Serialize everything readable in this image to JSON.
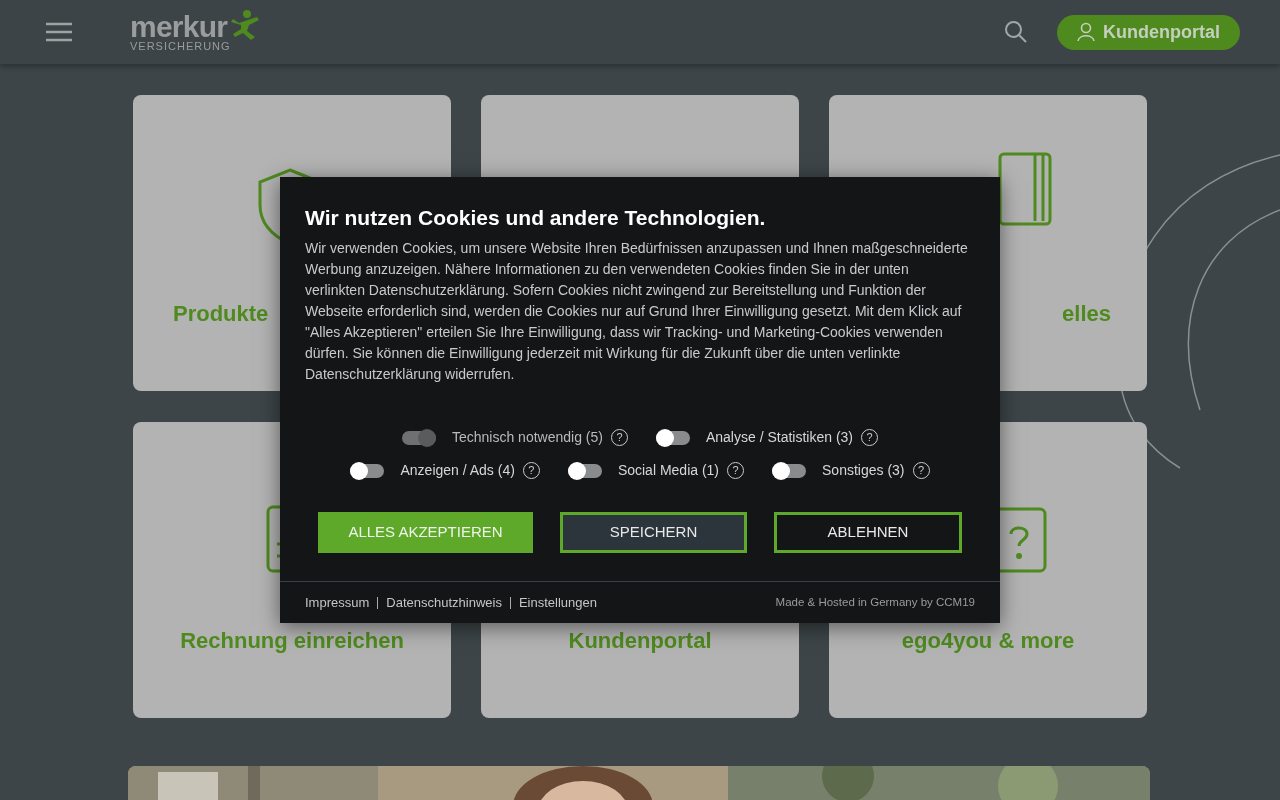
{
  "header": {
    "logo": {
      "name": "merkur",
      "tagline": "VERSICHERUNG"
    },
    "portal_button": "Kundenportal"
  },
  "cards": [
    {
      "kind": "tile",
      "title": "Produkte"
    },
    {
      "kind": "tile"
    },
    {
      "kind": "tile",
      "title": "elles"
    },
    {
      "kind": "tile",
      "title": "Rechnung einreichen"
    },
    {
      "kind": "tile",
      "title": "Kundenportal"
    },
    {
      "kind": "tile",
      "title": "ego4you & more"
    }
  ],
  "cookie_dialog": {
    "title": "Wir nutzen Cookies und andere Technologien.",
    "text": "Wir verwenden Cookies, um unsere Website Ihren Bedürfnissen anzupassen und Ihnen maßgeschneiderte Werbung anzuzeigen. Nähere Informationen zu den verwendeten Cookies finden Sie in der unten verlinkten Datenschutzerklärung. Sofern Cookies nicht zwingend zur Bereitstellung und Funktion der Webseite erforderlich sind, werden die Cookies nur auf Grund Ihrer Einwilligung gesetzt. Mit dem Klick auf \"Alles Akzeptieren\" erteilen Sie Ihre Einwilligung, dass wir Tracking- und Marketing-Cookies verwenden dürfen. Sie können die Einwilligung jederzeit mit Wirkung für die Zukunft über die unten verlinkte Datenschutzerklärung widerrufen.",
    "categories": [
      [
        {
          "label": "Technisch notwendig (5)",
          "on": true,
          "disabled": true
        },
        {
          "label": "Analyse / Statistiken (3)",
          "on": false,
          "disabled": false
        }
      ],
      [
        {
          "label": "Anzeigen / Ads (4)",
          "on": false,
          "disabled": false
        },
        {
          "label": "Social Media (1)",
          "on": false,
          "disabled": false
        },
        {
          "label": "Sonstiges (3)",
          "on": false,
          "disabled": false
        }
      ]
    ],
    "help_mark": "?",
    "buttons": [
      {
        "label": "ALLES AKZEPTIEREN",
        "kind": "primary"
      },
      {
        "label": "SPEICHERN",
        "kind": "secondary"
      },
      {
        "label": "ABLEHNEN",
        "kind": "outline"
      }
    ],
    "links": [
      "Impressum",
      "Datenschutzhinweis",
      "Einstellungen"
    ],
    "credit": "Made & Hosted in Germany by CCM19"
  }
}
